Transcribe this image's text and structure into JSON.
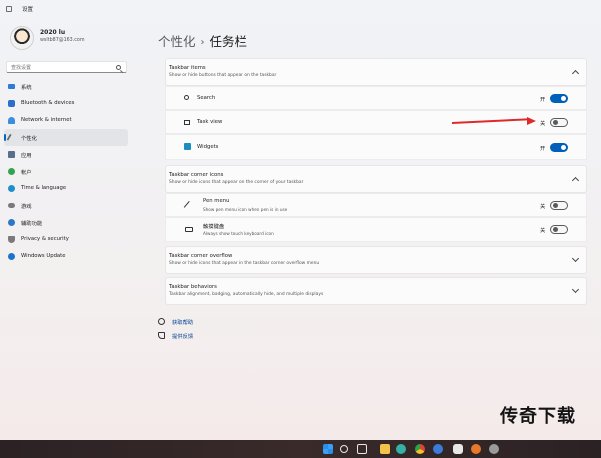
{
  "window": {
    "title": "设置"
  },
  "profile": {
    "name": "2020 lu",
    "email": "wsltb87@163.com"
  },
  "search": {
    "placeholder": "查找设置"
  },
  "sidebar": {
    "items": [
      {
        "label": "系统",
        "icon": "monitor-icon",
        "color": "#2f7bd6"
      },
      {
        "label": "Bluetooth & devices",
        "icon": "bluetooth-icon",
        "color": "#2a6fc9"
      },
      {
        "label": "Network & internet",
        "icon": "wifi-icon",
        "color": "#3a8ee0"
      },
      {
        "label": "个性化",
        "icon": "brush-icon",
        "color": "#6b6b6b"
      },
      {
        "label": "应用",
        "icon": "apps-icon",
        "color": "#5a6f8a"
      },
      {
        "label": "帐户",
        "icon": "account-icon",
        "color": "#2fa44f"
      },
      {
        "label": "Time & language",
        "icon": "globe-icon",
        "color": "#1f8fc7"
      },
      {
        "label": "游戏",
        "icon": "gamepad-icon",
        "color": "#7a7a7a"
      },
      {
        "label": "辅助功能",
        "icon": "accessibility-icon",
        "color": "#2c77c8"
      },
      {
        "label": "Privacy & security",
        "icon": "shield-icon",
        "color": "#7a7a7a"
      },
      {
        "label": "Windows Update",
        "icon": "update-icon",
        "color": "#1c73cf"
      }
    ],
    "active_index": 3
  },
  "breadcrumb": {
    "parent": "个性化",
    "separator": "›",
    "current": "任务栏"
  },
  "sections": {
    "items": {
      "title": "Taskbar items",
      "subtitle": "Show or hide buttons that appear on the taskbar",
      "rows": [
        {
          "label": "Search",
          "state": "开",
          "on": true,
          "icon": "search-icon"
        },
        {
          "label": "Task view",
          "state": "关",
          "on": false,
          "icon": "task-view-icon"
        },
        {
          "label": "Widgets",
          "state": "开",
          "on": true,
          "icon": "widgets-icon"
        }
      ]
    },
    "corner_icons": {
      "title": "Taskbar corner icons",
      "subtitle": "Show or hide icons that appear on the corner of your taskbar",
      "rows": [
        {
          "label": "Pen menu",
          "sub": "Show pen menu icon when pen is in use",
          "state": "关",
          "on": false,
          "icon": "pen-icon"
        },
        {
          "label": "触摸键盘",
          "sub": "Always show touch keyboard icon",
          "state": "关",
          "on": false,
          "icon": "keyboard-icon"
        }
      ]
    },
    "overflow": {
      "title": "Taskbar corner overflow",
      "subtitle": "Show or hide icons that appear in the taskbar corner overflow menu"
    },
    "behaviors": {
      "title": "Taskbar behaviors",
      "subtitle": "Taskbar alignment, badging, automatically hide, and multiple displays"
    }
  },
  "links": {
    "help": "获取帮助",
    "feedback": "提供反馈"
  },
  "watermark": "传奇下载",
  "colors": {
    "accent": "#005fb8",
    "annotation_arrow": "#e02a2a"
  }
}
